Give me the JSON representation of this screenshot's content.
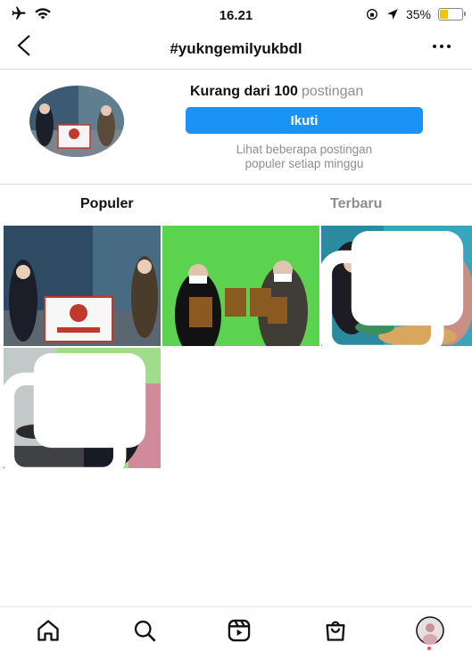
{
  "status_bar": {
    "time": "16.21",
    "battery": "35%"
  },
  "header": {
    "title": "#yukngemilyukbdl",
    "back_icon": "chevron-left-icon",
    "more_icon": "more-horizontal-icon"
  },
  "profile": {
    "count_bold": "Kurang dari 100",
    "count_suffix": "postingan",
    "follow_label": "Ikuti",
    "note_line1": "Lihat beberapa postingan",
    "note_line2": "populer setiap minggu"
  },
  "tabs": [
    {
      "label": "Populer"
    },
    {
      "label": "Terbaru"
    }
  ],
  "grid": [
    {
      "alt": "post-1",
      "multi": false
    },
    {
      "alt": "post-2",
      "multi": false
    },
    {
      "alt": "post-3",
      "multi": true
    },
    {
      "alt": "post-4",
      "multi": true
    }
  ],
  "bottom_nav": [
    "home-icon",
    "search-icon",
    "reels-icon",
    "shop-icon",
    "profile-avatar"
  ],
  "colors": {
    "accent": "#1a93f7",
    "muted": "#8e8e8e"
  }
}
